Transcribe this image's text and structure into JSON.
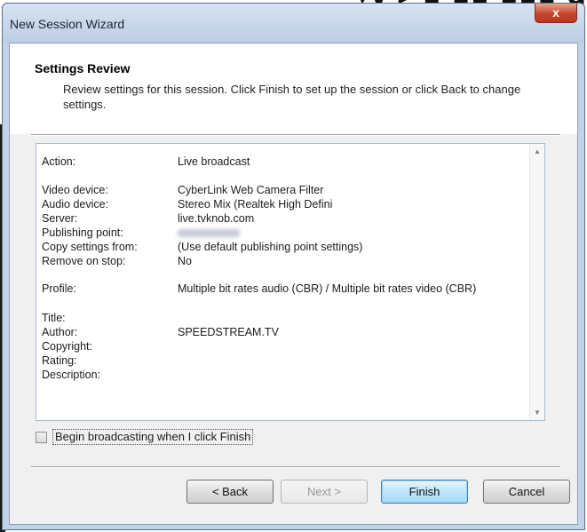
{
  "window": {
    "title": "New Session Wizard",
    "close_label": "x"
  },
  "header": {
    "title": "Settings Review",
    "description": "Review settings for this session. Click Finish to set up the session or click Back to change settings."
  },
  "review": {
    "rows": [
      {
        "key": "Action:",
        "value": "Live broadcast"
      },
      {
        "key": "Video device:",
        "value": "CyberLink Web Camera Filter"
      },
      {
        "key": "Audio device:",
        "value": "Stereo Mix (Realtek High Defini"
      },
      {
        "key": "Server:",
        "value": "live.tvknob.com"
      },
      {
        "key": "Publishing point:",
        "value": ""
      },
      {
        "key": "Copy settings from:",
        "value": "(Use default publishing point settings)"
      },
      {
        "key": "Remove on stop:",
        "value": "No"
      },
      {
        "key": "Profile:",
        "value": "Multiple bit rates audio (CBR) / Multiple bit rates video (CBR)"
      },
      {
        "key": "Title:",
        "value": ""
      },
      {
        "key": "Author:",
        "value": "SPEEDSTREAM.TV"
      },
      {
        "key": "Copyright:",
        "value": ""
      },
      {
        "key": "Rating:",
        "value": ""
      },
      {
        "key": "Description:",
        "value": ""
      }
    ]
  },
  "options": {
    "begin_broadcasting_label": "Begin broadcasting when I click Finish",
    "begin_broadcasting_checked": false
  },
  "buttons": {
    "back": "< Back",
    "next": "Next >",
    "finish": "Finish",
    "cancel": "Cancel"
  }
}
